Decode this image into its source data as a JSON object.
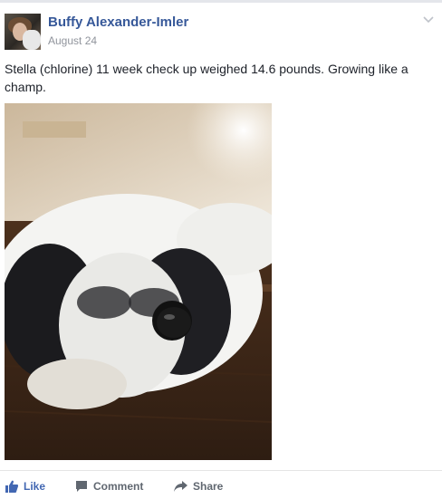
{
  "post": {
    "author": "Buffy Alexander-Imler",
    "date": "August 24",
    "text": "Stella (chlorine) 11 week check up weighed 14.6 pounds. Growing like a champ.",
    "photo_icon": "photo"
  },
  "actions": {
    "like": "Like",
    "comment": "Comment",
    "share": "Share"
  },
  "colors": {
    "author": "#365899",
    "like_active": "#4267b2",
    "meta": "#90949c",
    "action": "#606770"
  },
  "icons": [
    "thumbs-up-icon",
    "comment-icon",
    "share-icon",
    "chevron-down-icon"
  ]
}
